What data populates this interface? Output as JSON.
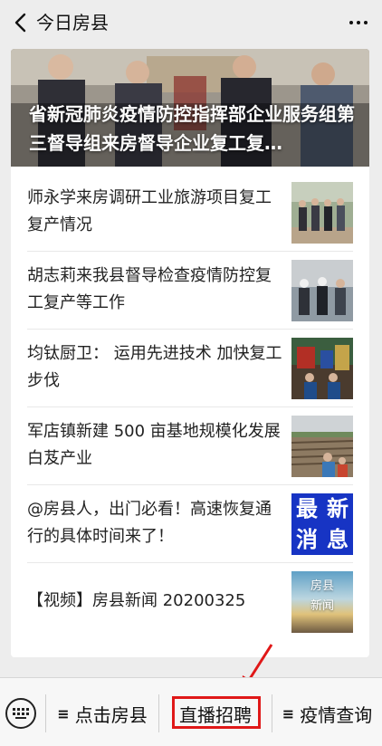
{
  "header": {
    "title": "今日房县",
    "back_icon": "chevron-left-icon",
    "more_icon": "more-dots-icon"
  },
  "feature": {
    "title": "省新冠肺炎疫情防控指挥部企业服务组第三督导组来房督导企业复工复…"
  },
  "articles": [
    {
      "title": "师永学来房调研工业旅游项目复工复产情况"
    },
    {
      "title": "胡志莉来我县督导检查疫情防控复工复产等工作"
    },
    {
      "title": "均钛厨卫： 运用先进技术 加快复工步伐"
    },
    {
      "title": "军店镇新建 500 亩基地规模化发展白芨产业"
    },
    {
      "title": "@房县人，出门必看！高速恢复通行的具体时间来了！",
      "thumb_text": [
        "最",
        "新",
        "消",
        "息"
      ]
    },
    {
      "title": "【视频】房县新闻 20200325",
      "thumb_text": [
        "房县",
        "新闻"
      ]
    }
  ],
  "menu": {
    "keyboard_icon": "keyboard-icon",
    "items": [
      {
        "label": "点击房县",
        "has_submenu": true
      },
      {
        "label": "直播招聘",
        "has_submenu": false
      },
      {
        "label": "疫情查询",
        "has_submenu": true
      }
    ],
    "submenu_icon": "≡"
  },
  "annotation": {
    "highlight_color": "#e01818"
  }
}
